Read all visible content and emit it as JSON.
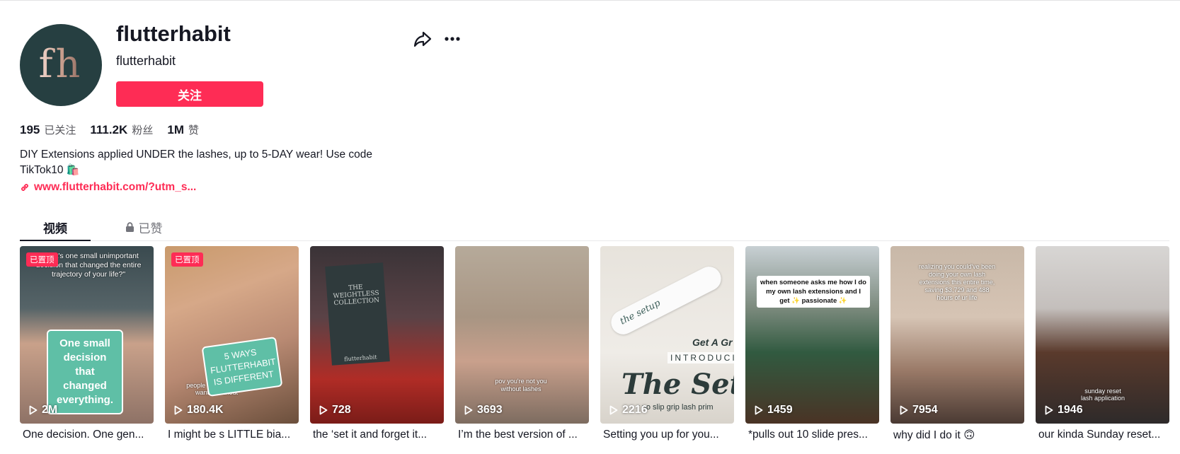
{
  "profile": {
    "avatar_text": "fh",
    "name": "flutterhabit",
    "handle": "flutterhabit",
    "follow_label": "关注",
    "stats": [
      {
        "value": "195",
        "label": "已关注"
      },
      {
        "value": "111.2K",
        "label": "粉丝"
      },
      {
        "value": "1M",
        "label": "赞"
      }
    ],
    "bio_line1": "DIY Extensions applied UNDER the lashes, up to 5-DAY wear! Use code",
    "bio_line2": "TikTok10",
    "bio_emoji": "🛍️",
    "link": "www.flutterhabit.com/?utm_s..."
  },
  "icons": {
    "share": "share-icon",
    "more": "more-icon",
    "link": "link-icon",
    "lock": "lock-icon",
    "play": "play-icon"
  },
  "tabs": {
    "videos": "视频",
    "liked": "已赞"
  },
  "pinned_label": "已置顶",
  "videos": [
    {
      "plays": "2M",
      "caption": "One decision. One gen...",
      "overlay": "\"What's one small unimportant decision that changed the entire trajectory of your life?\"",
      "sticker": "One small decision that changed everything."
    },
    {
      "plays": "180.4K",
      "caption": "I might be s LITTLE bia...",
      "sticker": "5 WAYS FLUTTERHABIT IS DIFFERENT",
      "overlay": "people ... lash ... they wanted without"
    },
    {
      "plays": "728",
      "caption": "the ‘set it and forget it...",
      "overlay": "THE WEIGHTLESS COLLECTION",
      "box_small": "flutterhabit"
    },
    {
      "plays": "3693",
      "caption": "I’m the best version of ...",
      "overlay": "pov you're not you without lashes"
    },
    {
      "plays": "2216",
      "caption": "Setting you up for you...",
      "overlay_get": "Get A Gr",
      "overlay_intro": "INTRODUCIN",
      "overlay_title": "The Setup",
      "overlay_sub": "r no slip grip lash prim",
      "pen_text": "the setup"
    },
    {
      "plays": "1459",
      "caption": "*pulls out 10 slide pres...",
      "overlay": "when someone asks me how I do my own lash extensions and I get ✨ passionate ✨"
    },
    {
      "plays": "7954",
      "caption": "why did I do it 🙃",
      "overlay": "realizing you could've been doing your own lash extensions this entire time, saving $3,729 and 488 hours of ur life"
    },
    {
      "plays": "1946",
      "caption": "our kinda Sunday reset...",
      "overlay": "sunday reset lash application"
    }
  ]
}
